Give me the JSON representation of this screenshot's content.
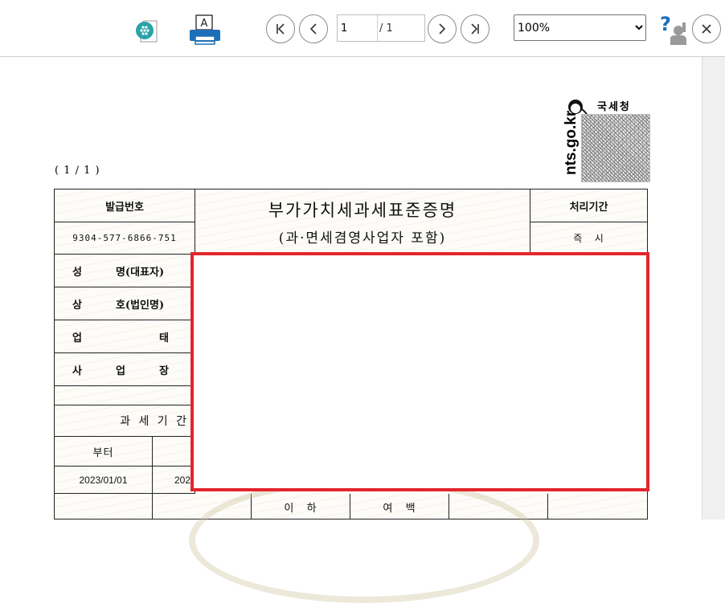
{
  "toolbar": {
    "icons": [
      "save-icon",
      "print-icon",
      "first-page-icon",
      "prev-page-icon",
      "next-page-icon",
      "last-page-icon",
      "help-icon",
      "close-icon"
    ],
    "page_input": "1",
    "page_total": "/ 1",
    "zoom": "100%",
    "zoom_options": [
      "100%"
    ]
  },
  "document": {
    "page_indicator": "( 1 / 1 )",
    "agency": {
      "name": "국세청",
      "url": "nts.go.kr"
    },
    "title": "부가가치세과세표준증명",
    "subtitle": "(과·면세겸영사업자 포함)",
    "issue_no_label": "발급번호",
    "issue_no": "9304-577-6866-751",
    "processing_label": "처리기간",
    "processing_value": "즉   시",
    "rows": {
      "name_a": "성",
      "name_b": "명(대표자)",
      "trade_a": "상",
      "trade_b": "호(법인명)",
      "biz_a": "업",
      "biz_b": "태",
      "site_a": "사",
      "site_b": "업",
      "site_c": "장"
    },
    "period_label": "과 세 기 간",
    "from_label": "부터",
    "from_date": "2023/01/01",
    "to_date_partial": "202",
    "below_label": "이   하",
    "blank_label": "여   백"
  },
  "colors": {
    "redact_border": "#e3252c",
    "accent_teal": "#2aa3a8",
    "print_blue": "#1d6fb8"
  }
}
